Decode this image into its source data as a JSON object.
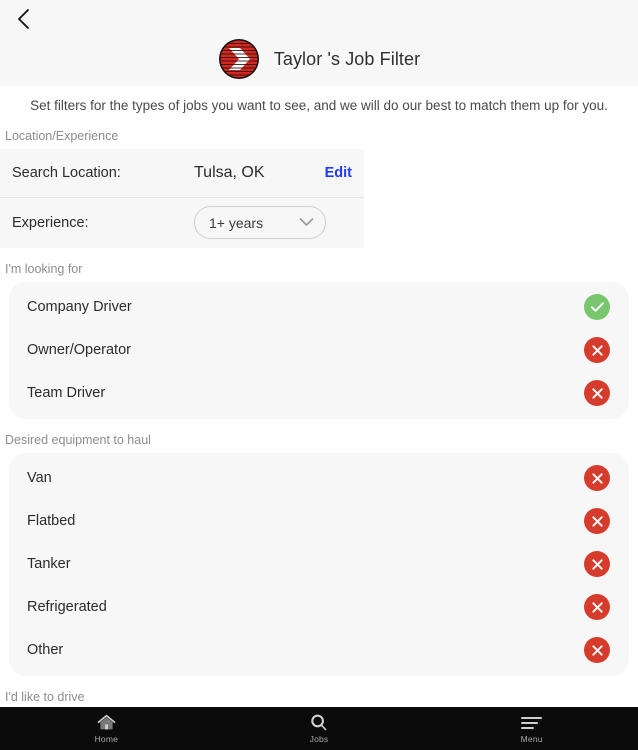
{
  "header": {
    "back_icon": "chevron-left-icon",
    "logo_icon": "circle-chevron-logo",
    "title": "Taylor 's Job Filter"
  },
  "intro": {
    "text": "Set filters for the types of jobs you want to see, and we will do our best to match them up for you."
  },
  "location_experience": {
    "section_label": "Location/Experience",
    "search_location": {
      "label": "Search Location:",
      "value": "Tulsa, OK",
      "edit_label": "Edit"
    },
    "experience": {
      "label": "Experience:",
      "value": "1+ years",
      "dropdown_icon": "chevron-down-icon"
    }
  },
  "looking_for": {
    "section_label": "I'm looking for",
    "items": [
      {
        "label": "Company Driver",
        "state": "yes",
        "icon": "check-circle-icon"
      },
      {
        "label": "Owner/Operator",
        "state": "no",
        "icon": "x-circle-icon"
      },
      {
        "label": "Team Driver",
        "state": "no",
        "icon": "x-circle-icon"
      }
    ]
  },
  "equipment": {
    "section_label": "Desired equipment to haul",
    "items": [
      {
        "label": "Van",
        "state": "no",
        "icon": "x-circle-icon"
      },
      {
        "label": "Flatbed",
        "state": "no",
        "icon": "x-circle-icon"
      },
      {
        "label": "Tanker",
        "state": "no",
        "icon": "x-circle-icon"
      },
      {
        "label": "Refrigerated",
        "state": "no",
        "icon": "x-circle-icon"
      },
      {
        "label": "Other",
        "state": "no",
        "icon": "x-circle-icon"
      }
    ]
  },
  "drive": {
    "section_label": "I'd like to drive"
  },
  "bottom_nav": {
    "items": [
      {
        "label": "Home",
        "icon": "home-icon"
      },
      {
        "label": "Jobs",
        "icon": "search-icon"
      },
      {
        "label": "Menu",
        "icon": "hamburger-menu-icon"
      }
    ]
  },
  "colors": {
    "accent_red": "#d63c2b",
    "accent_green": "#78c76e",
    "link_blue": "#1f3bff",
    "card_bg": "#f7f7f7",
    "nav_bg": "#0b0b0b"
  }
}
